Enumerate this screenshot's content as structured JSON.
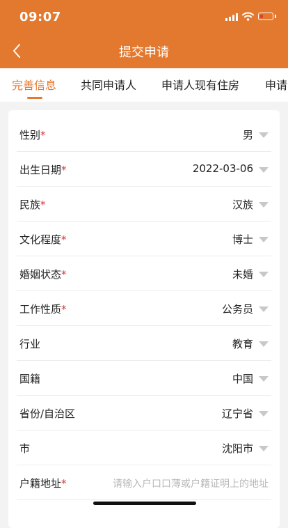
{
  "status_bar": {
    "time": "09:07"
  },
  "header": {
    "title": "提交申请"
  },
  "tabs": [
    {
      "label": "完善信息",
      "active": true
    },
    {
      "label": "共同申请人",
      "active": false
    },
    {
      "label": "申请人现有住房",
      "active": false
    },
    {
      "label": "申请",
      "active": false
    }
  ],
  "form": {
    "rows": [
      {
        "label": "性别",
        "required": "*",
        "value": "男"
      },
      {
        "label": "出生日期",
        "required": "*",
        "value": "2022-03-06"
      },
      {
        "label": "民族",
        "required": "*",
        "value": "汉族"
      },
      {
        "label": "文化程度",
        "required": "*",
        "value": "博士"
      },
      {
        "label": "婚姻状态",
        "required": "*",
        "value": "未婚"
      },
      {
        "label": "工作性质",
        "required": "*",
        "value": "公务员"
      },
      {
        "label": "行业",
        "required": "",
        "value": "教育"
      },
      {
        "label": "国籍",
        "required": "",
        "value": "中国"
      },
      {
        "label": "省份/自治区",
        "required": "",
        "value": "辽宁省"
      },
      {
        "label": "市",
        "required": "",
        "value": "沈阳市"
      }
    ],
    "household_address": {
      "label": "户籍地址",
      "required": "*",
      "placeholder": "请输入户口口薄或户籍证明上的地址"
    }
  },
  "colors": {
    "accent": "#e3792f",
    "required": "#d9363e"
  },
  "icons": {
    "back": "chevron-left-icon",
    "dropdown": "caret-down-icon"
  }
}
